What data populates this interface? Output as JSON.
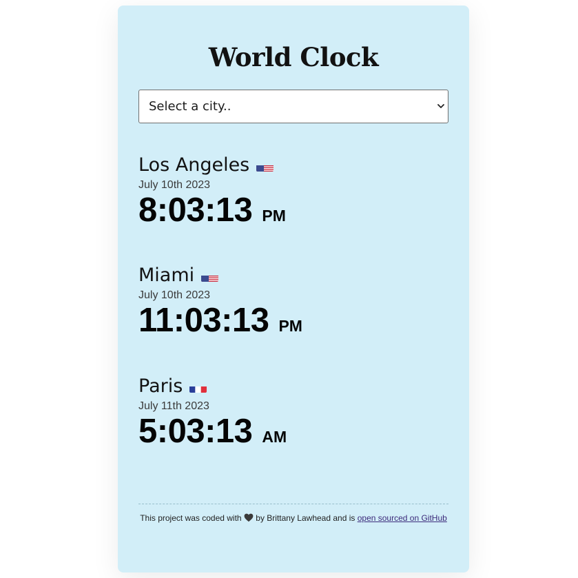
{
  "app": {
    "title": "World Clock"
  },
  "city_select": {
    "selected_label": "Select a city.."
  },
  "cities": [
    {
      "name": "Los Angeles",
      "flag_icon": "us-flag-icon",
      "date": "July 10th 2023",
      "time": "8:03:13",
      "ampm": "PM"
    },
    {
      "name": "Miami",
      "flag_icon": "us-flag-icon",
      "date": "July 10th 2023",
      "time": "11:03:13",
      "ampm": "PM"
    },
    {
      "name": "Paris",
      "flag_icon": "france-flag-icon",
      "date": "July 11th 2023",
      "time": "5:03:13",
      "ampm": "AM"
    }
  ],
  "footer": {
    "text_before": "This project was coded with",
    "heart_icon": "black-heart-icon",
    "text_middle": "by Brittany Lawhead and is",
    "link_label": "open sourced on GitHub"
  },
  "colors": {
    "card_background": "#d2eef8",
    "link": "#3b2a7a"
  }
}
